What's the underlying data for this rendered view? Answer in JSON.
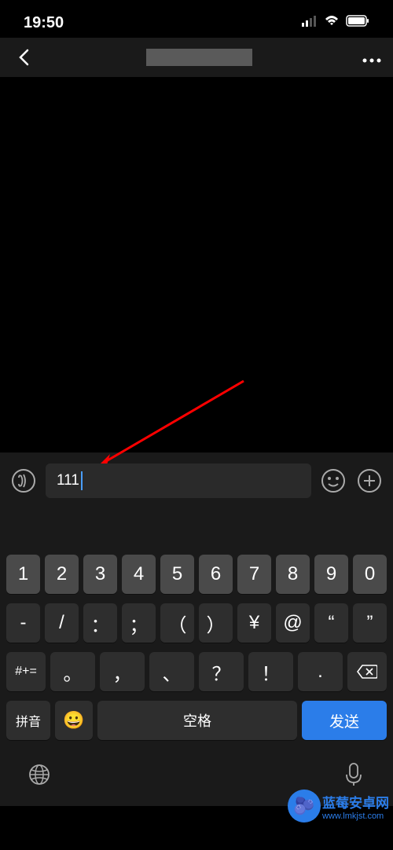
{
  "status_bar": {
    "time": "19:50"
  },
  "input": {
    "value": "111"
  },
  "keyboard": {
    "row1": [
      "1",
      "2",
      "3",
      "4",
      "5",
      "6",
      "7",
      "8",
      "9",
      "0"
    ],
    "row2": [
      "-",
      "/",
      "：",
      "；",
      "（",
      "）",
      "¥",
      "@",
      "“",
      "”"
    ],
    "row3_sym": "#+=",
    "row3": [
      "。",
      "，",
      "、",
      "？",
      "！",
      "."
    ],
    "mode": "拼音",
    "emoji": "😀",
    "space": "空格",
    "send": "发送"
  },
  "watermark": {
    "title": "蓝莓安卓网",
    "url": "www.lmkjst.com"
  }
}
